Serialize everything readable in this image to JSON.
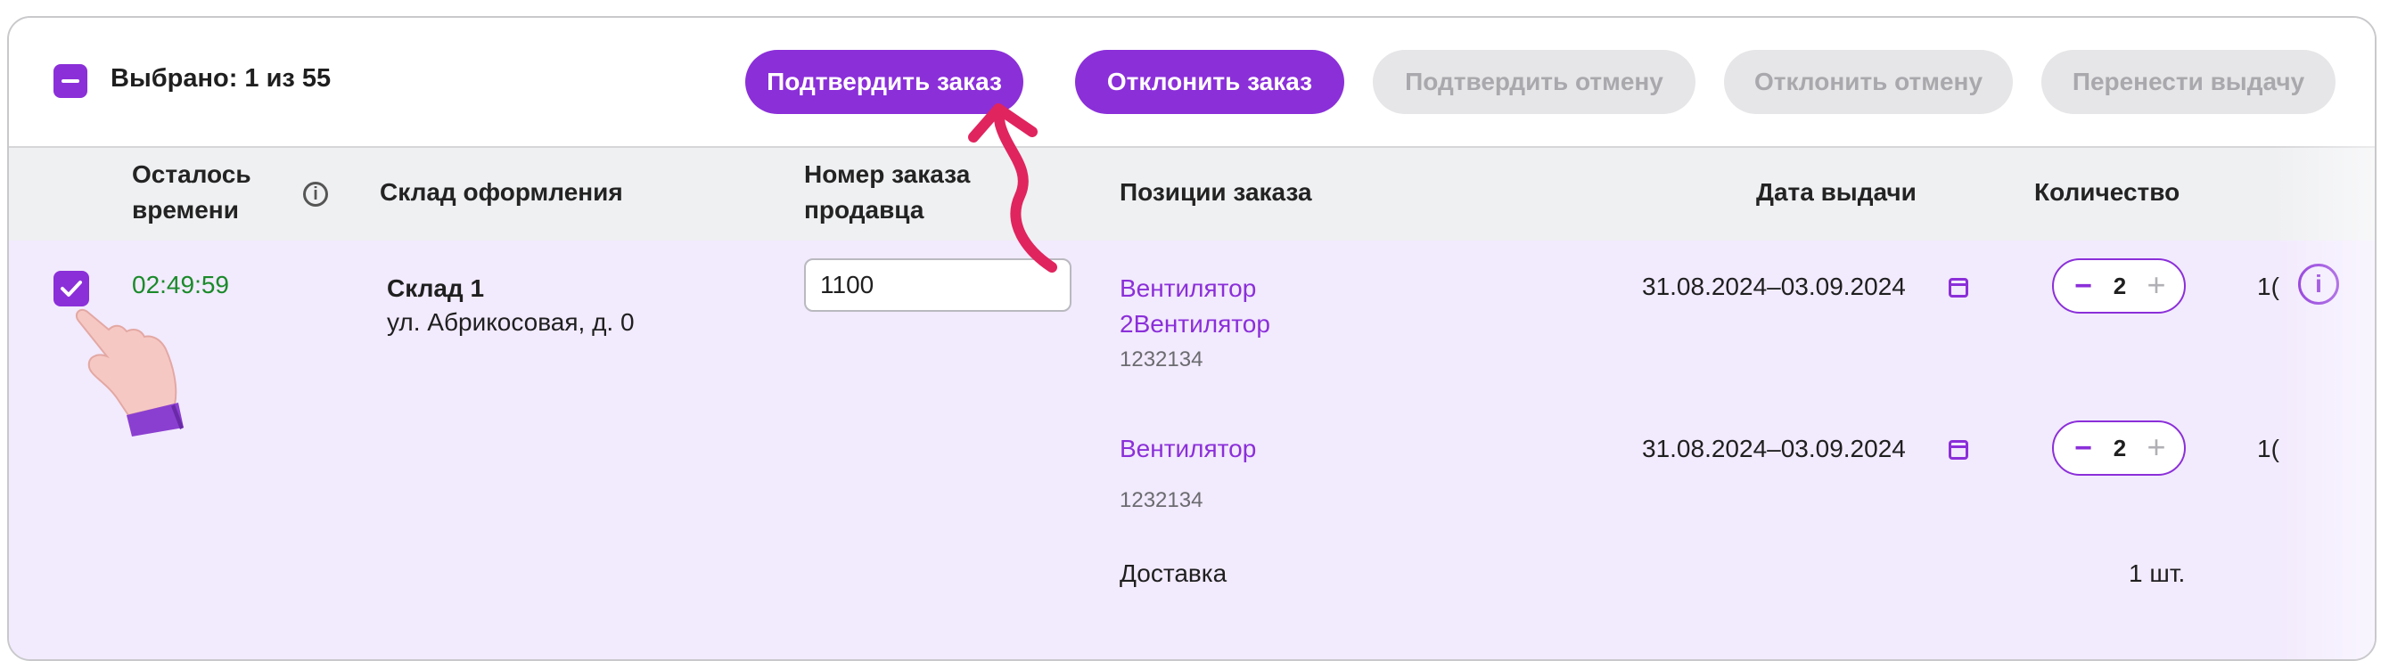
{
  "toolbar": {
    "selected_text": "Выбрано: 1 из 55",
    "confirm_order": "Подтвердить заказ",
    "reject_order": "Отклонить заказ",
    "confirm_cancel": "Подтвердить отмену",
    "reject_cancel": "Отклонить отмену",
    "reschedule": "Перенести выдачу"
  },
  "table": {
    "headers": {
      "time_left_1": "Осталось",
      "time_left_2": "времени",
      "warehouse": "Склад оформления",
      "order_no_1": "Номер заказа",
      "order_no_2": "продавца",
      "positions": "Позиции заказа",
      "date": "Дата выдачи",
      "quantity": "Количество"
    },
    "row": {
      "timer": "02:49:59",
      "warehouse_name": "Склад 1",
      "warehouse_address": "ул. Абрикосовая, д. 0",
      "order_number": "1100",
      "positions": [
        {
          "name_line1": "Вентилятор",
          "name_line2": "2Вентилятор",
          "code": "1232134",
          "date": "31.08.2024–03.09.2024",
          "qty": "2",
          "cut": "1("
        },
        {
          "name_line1": "Вентилятор",
          "name_line2": "",
          "code": "1232134",
          "date": "31.08.2024–03.09.2024",
          "qty": "2",
          "cut": "1("
        }
      ],
      "delivery_label": "Доставка",
      "delivery_qty": "1 шт."
    }
  },
  "colors": {
    "accent": "#8b2fd9",
    "timer": "#1a8a2a",
    "row_bg": "#f2eafd",
    "arrow": "#e0245e"
  },
  "icons": [
    "minus-checkbox-icon",
    "info-icon",
    "checkmark-icon",
    "calendar-icon",
    "minus-icon",
    "plus-icon",
    "pointing-hand-icon",
    "arrow-annotation-icon"
  ]
}
